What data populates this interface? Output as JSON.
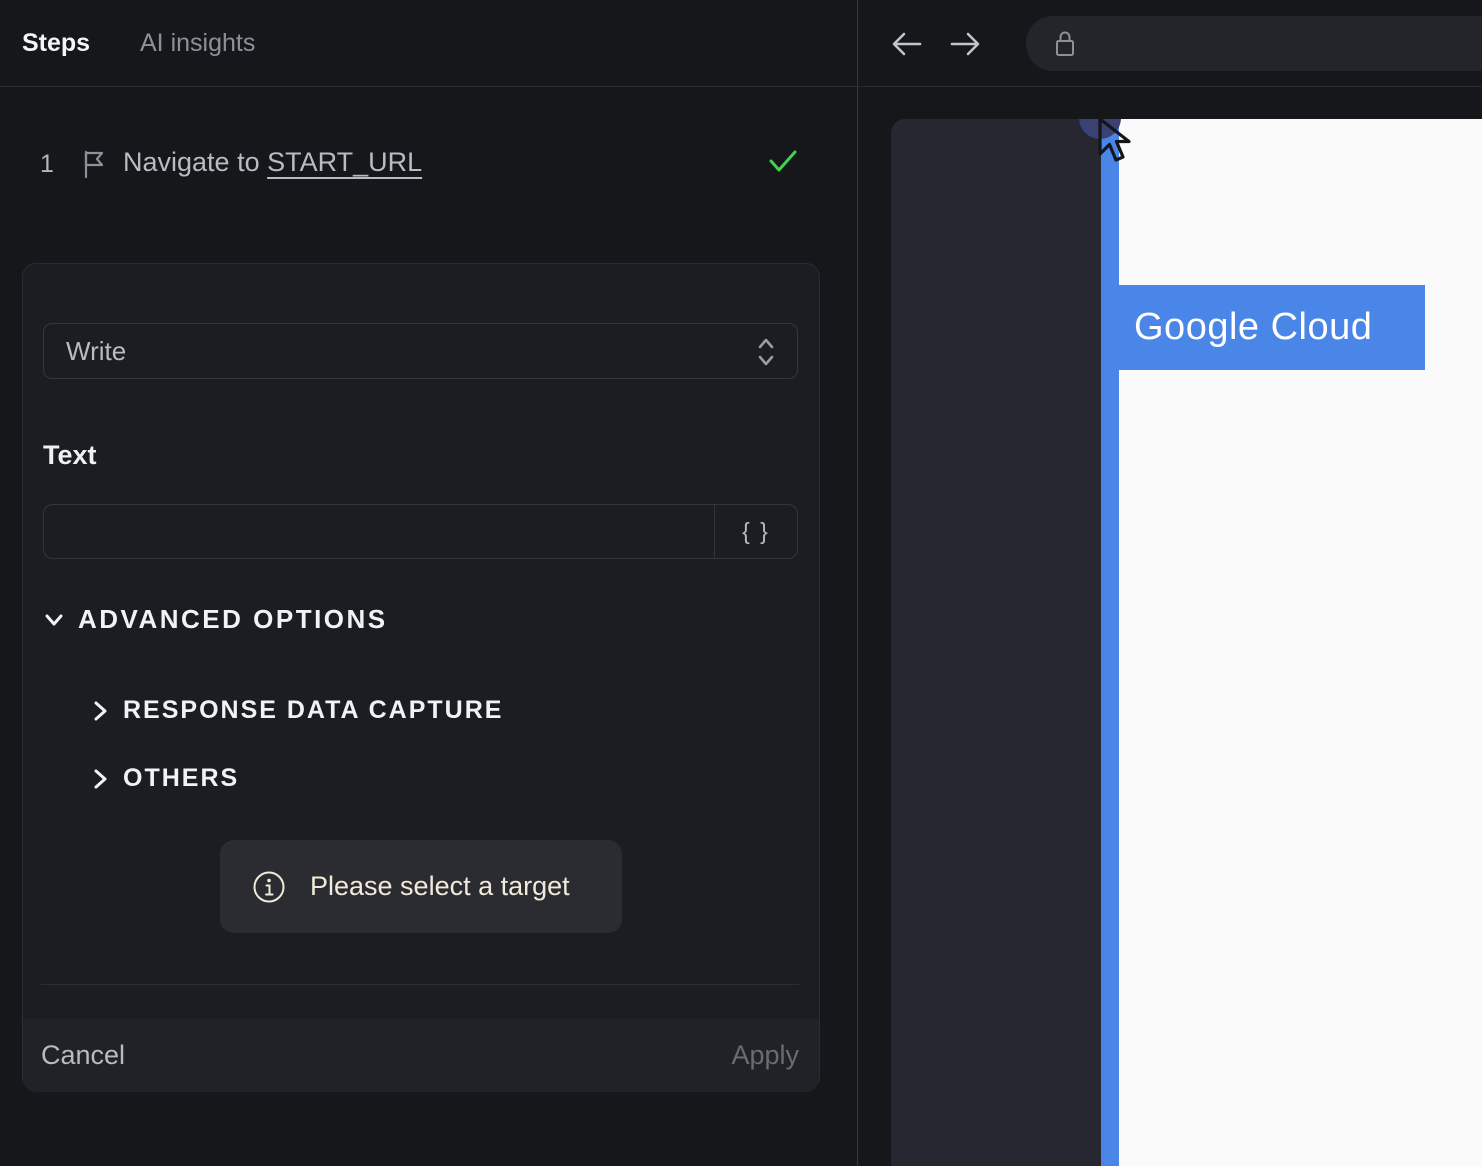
{
  "colors": {
    "accent_blue": "#4a86e8",
    "success_green": "#41d24f",
    "panel_bg": "#16171b",
    "card_bg": "#1c1d22",
    "viewport_bg": "#262731",
    "page_white": "#fafafa",
    "info_text": "#f1ead9"
  },
  "left_panel": {
    "tabs": [
      {
        "label": "Steps",
        "active": true
      },
      {
        "label": "AI insights",
        "active": false
      }
    ],
    "step": {
      "number": "1",
      "text": "Navigate to",
      "link": "START_URL",
      "status": "success"
    },
    "editor": {
      "action_select": {
        "value": "Write"
      },
      "text_field": {
        "label": "Text",
        "value": "",
        "placeholder": ""
      },
      "variable_button_label": "{ }",
      "advanced_options": {
        "label": "ADVANCED OPTIONS",
        "expanded": true
      },
      "sections": [
        {
          "label": "RESPONSE DATA CAPTURE",
          "expanded": false
        },
        {
          "label": "OTHERS",
          "expanded": false
        }
      ],
      "info_message": "Please select a target",
      "footer": {
        "cancel_label": "Cancel",
        "apply_label": "Apply",
        "apply_enabled": false
      }
    }
  },
  "browser_panel": {
    "toolbar": {
      "url_value": ""
    },
    "page": {
      "highlight_label": "Google Cloud"
    }
  }
}
